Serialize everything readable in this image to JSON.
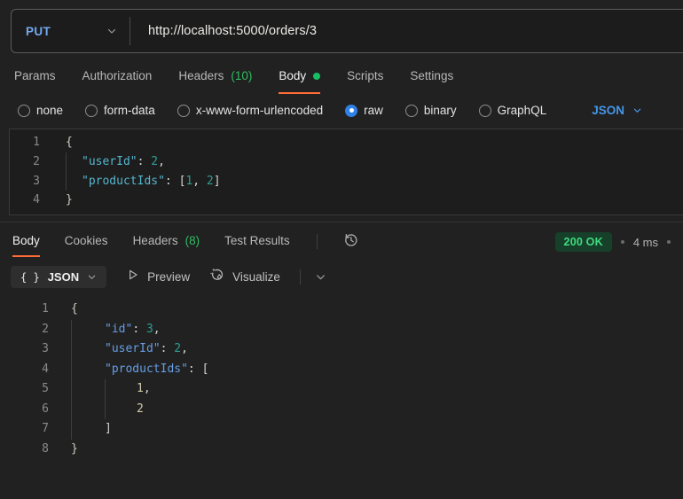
{
  "request_bar": {
    "method": "PUT",
    "url": "http://localhost:5000/orders/3"
  },
  "request_tabs": {
    "params": "Params",
    "authorization": "Authorization",
    "headers": "Headers",
    "headers_count": "(10)",
    "body": "Body",
    "scripts": "Scripts",
    "settings": "Settings"
  },
  "body_types": {
    "none": "none",
    "form_data": "form-data",
    "urlencoded": "x-www-form-urlencoded",
    "raw": "raw",
    "binary": "binary",
    "graphql": "GraphQL",
    "raw_format": "JSON"
  },
  "request_editor": {
    "lines": [
      {
        "n": "1",
        "guides": 0,
        "segs": [
          {
            "c": "brace",
            "t": "{"
          }
        ]
      },
      {
        "n": "2",
        "guides": 1,
        "segs": [
          {
            "c": "key",
            "t": "\"userId\""
          },
          {
            "c": "pun",
            "t": ": "
          },
          {
            "c": "num",
            "t": "2"
          },
          {
            "c": "pun",
            "t": ","
          }
        ]
      },
      {
        "n": "3",
        "guides": 1,
        "segs": [
          {
            "c": "key",
            "t": "\"productIds\""
          },
          {
            "c": "pun",
            "t": ": "
          },
          {
            "c": "pun",
            "t": "["
          },
          {
            "c": "num",
            "t": "1"
          },
          {
            "c": "pun",
            "t": ", "
          },
          {
            "c": "num",
            "t": "2"
          },
          {
            "c": "pun",
            "t": "]"
          }
        ]
      },
      {
        "n": "4",
        "guides": 0,
        "segs": [
          {
            "c": "brace",
            "t": "}"
          }
        ]
      }
    ]
  },
  "response": {
    "tabs": {
      "body": "Body",
      "cookies": "Cookies",
      "headers": "Headers",
      "headers_count": "(8)",
      "test_results": "Test Results"
    },
    "status": "200 OK",
    "time": "4 ms",
    "toolbar": {
      "format_icon": "{ }",
      "format_label": "JSON",
      "preview": "Preview",
      "visualize": "Visualize"
    }
  },
  "response_editor": {
    "lines": [
      {
        "n": "1",
        "guides": 0,
        "segs": [
          {
            "c": "brace",
            "t": "{"
          }
        ]
      },
      {
        "n": "2",
        "guides": 1,
        "segs": [
          {
            "c": "key",
            "t": "\"id\""
          },
          {
            "c": "pun",
            "t": ": "
          },
          {
            "c": "num",
            "t": "3"
          },
          {
            "c": "pun",
            "t": ","
          }
        ]
      },
      {
        "n": "3",
        "guides": 1,
        "segs": [
          {
            "c": "key",
            "t": "\"userId\""
          },
          {
            "c": "pun",
            "t": ": "
          },
          {
            "c": "num",
            "t": "2"
          },
          {
            "c": "pun",
            "t": ","
          }
        ]
      },
      {
        "n": "4",
        "guides": 1,
        "segs": [
          {
            "c": "key",
            "t": "\"productIds\""
          },
          {
            "c": "pun",
            "t": ": "
          },
          {
            "c": "pun",
            "t": "["
          }
        ]
      },
      {
        "n": "5",
        "guides": 2,
        "segs": [
          {
            "c": "pale",
            "t": "1"
          },
          {
            "c": "pun",
            "t": ","
          }
        ]
      },
      {
        "n": "6",
        "guides": 2,
        "segs": [
          {
            "c": "pale",
            "t": "2"
          }
        ]
      },
      {
        "n": "7",
        "guides": 1,
        "segs": [
          {
            "c": "pun",
            "t": "]"
          }
        ]
      },
      {
        "n": "8",
        "guides": 0,
        "segs": [
          {
            "c": "brace",
            "t": "}"
          }
        ]
      }
    ]
  },
  "colors": {
    "accent_orange": "#ff6c37",
    "method_blue": "#74a9f0",
    "link_blue": "#4596e8",
    "count_green": "#2fbd63",
    "status_badge_bg": "#16402a",
    "status_badge_text": "#3fdc7f",
    "key_request": "#54b6cf",
    "key_response": "#669ee4",
    "number_teal": "#2f9e93",
    "background": "#212121"
  }
}
